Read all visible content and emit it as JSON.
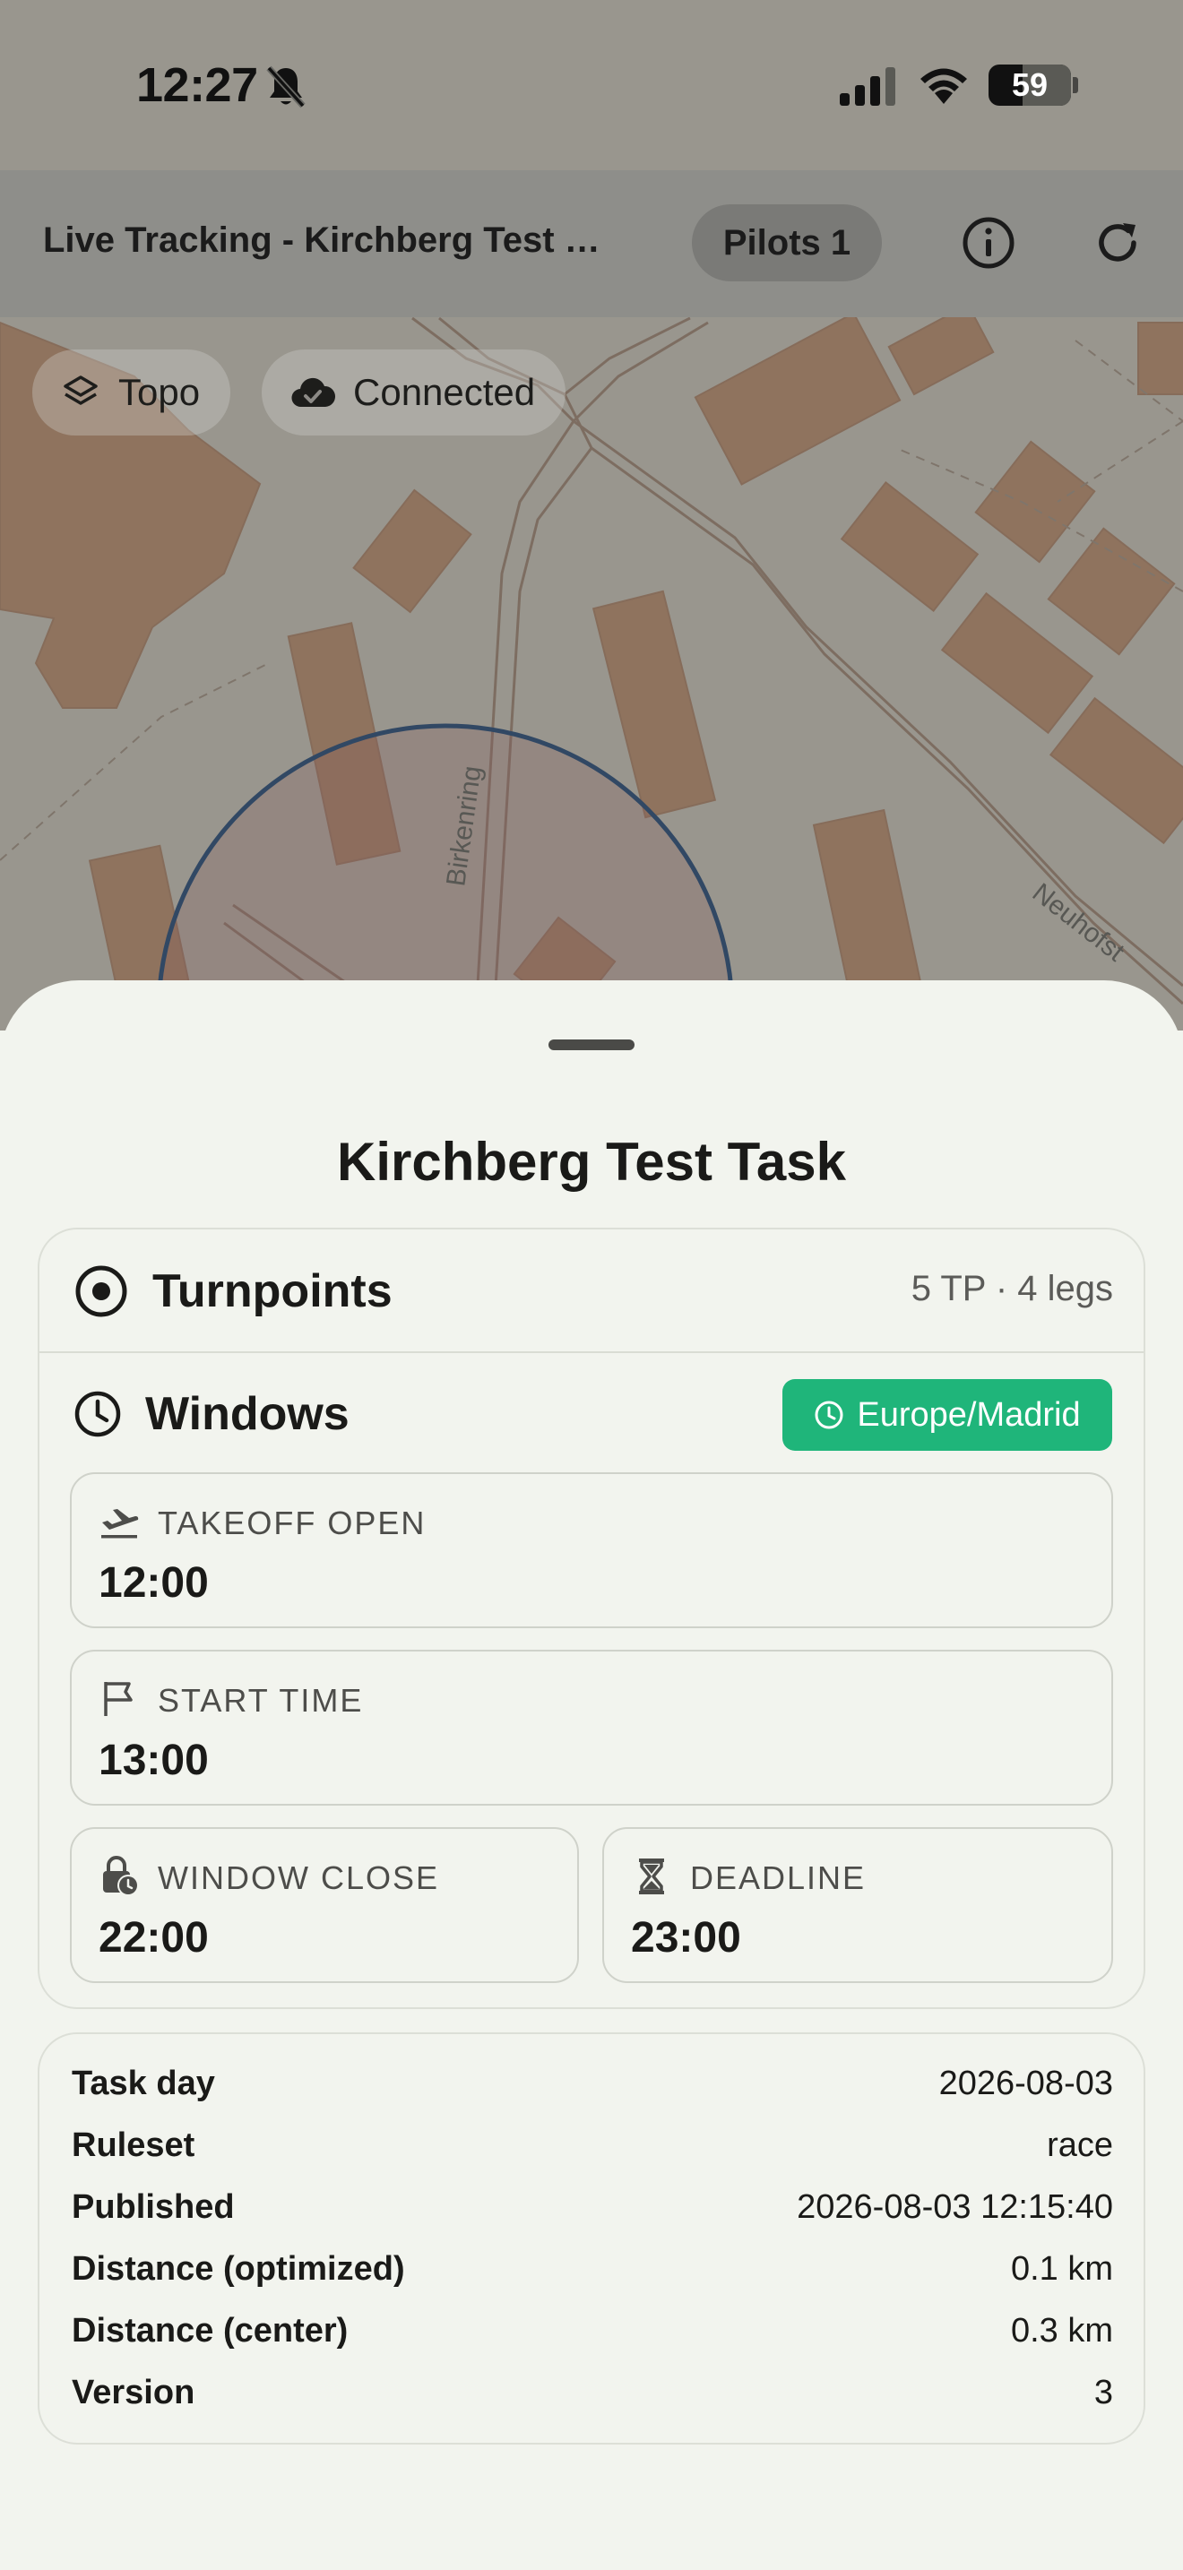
{
  "status_bar": {
    "time": "12:27",
    "battery": "59",
    "battery_level": 0.59
  },
  "app_bar": {
    "title": "Live Tracking - Kirchberg Test …",
    "pilots_label": "Pilots 1",
    "info_icon": "info-circle-icon",
    "refresh_icon": "refresh-icon"
  },
  "map": {
    "layer_chip": "Topo",
    "connection_chip": "Connected",
    "street_labels": [
      "Birkenring",
      "Neuhofst"
    ],
    "turnpoint_circle_color": "#1d4a86"
  },
  "sheet": {
    "title": "Kirchberg Test Task",
    "turnpoints": {
      "heading": "Turnpoints",
      "summary": "5 TP · 4 legs"
    },
    "windows": {
      "heading": "Windows",
      "timezone": "Europe/Madrid",
      "timezone_color": "#1fb57a",
      "takeoff_open": {
        "label": "TAKEOFF OPEN",
        "value": "12:00"
      },
      "start_time": {
        "label": "START TIME",
        "value": "13:00"
      },
      "window_close": {
        "label": "WINDOW CLOSE",
        "value": "22:00"
      },
      "deadline": {
        "label": "DEADLINE",
        "value": "23:00"
      }
    },
    "info": [
      {
        "key": "Task day",
        "value": "2026-08-03"
      },
      {
        "key": "Ruleset",
        "value": "race"
      },
      {
        "key": "Published",
        "value": "2026-08-03 12:15:40"
      },
      {
        "key": "Distance (optimized)",
        "value": "0.1 km"
      },
      {
        "key": "Distance (center)",
        "value": "0.3 km"
      },
      {
        "key": "Version",
        "value": "3"
      }
    ]
  }
}
